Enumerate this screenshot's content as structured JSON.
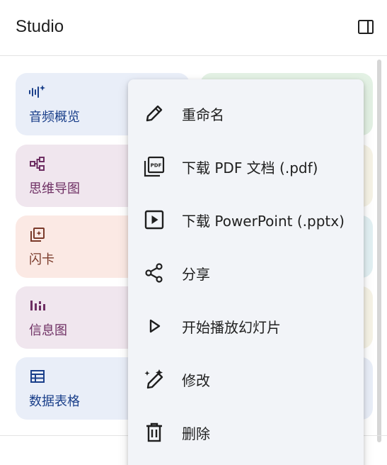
{
  "header": {
    "title": "Studio",
    "toggle_icon": "side-panel-icon"
  },
  "tiles": [
    {
      "label": "音频概览",
      "icon": "audio-waveform-sparkle-icon",
      "bg": "#e9eef8",
      "fg": "#1a3f8a"
    },
    {
      "label": "思维导图",
      "icon": "mind-map-icon",
      "bg": "#f0e6ee",
      "fg": "#6e2f63"
    },
    {
      "label": "闪卡",
      "icon": "flashcards-icon",
      "bg": "#fbe9e4",
      "fg": "#7a3a2a"
    },
    {
      "label": "信息图",
      "icon": "infographic-bars-icon",
      "bg": "#f0e6ee",
      "fg": "#6e2f63"
    },
    {
      "label": "数据表格",
      "icon": "data-table-icon",
      "bg": "#e9eef8",
      "fg": "#1a3f8a"
    }
  ],
  "right_tiles": [
    {
      "bg": "#e3f1e4"
    },
    {
      "bg": "#f6f3e6"
    },
    {
      "bg": "#e2f0f3"
    },
    {
      "bg": "#f6f3e6"
    },
    {
      "bg": "#e9eef8"
    }
  ],
  "menu": {
    "items": [
      {
        "label": "重命名",
        "icon": "pencil-icon"
      },
      {
        "label": "下载 PDF 文档 (.pdf)",
        "icon": "pdf-download-icon"
      },
      {
        "label": "下载 PowerPoint (.pptx)",
        "icon": "slideshow-icon"
      },
      {
        "label": "分享",
        "icon": "share-icon"
      },
      {
        "label": "开始播放幻灯片",
        "icon": "play-icon"
      },
      {
        "label": "修改",
        "icon": "edit-sparkle-icon"
      },
      {
        "label": "删除",
        "icon": "trash-icon"
      }
    ]
  }
}
